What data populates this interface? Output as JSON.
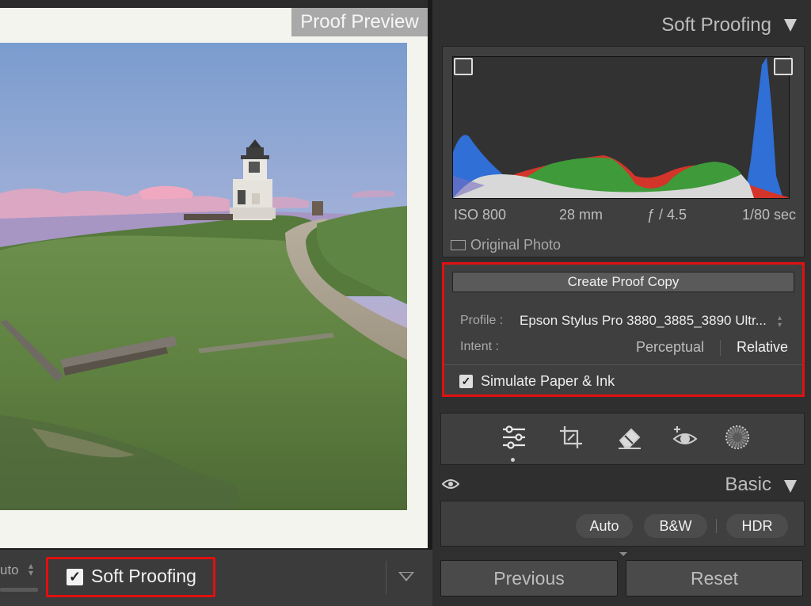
{
  "canvas": {
    "proof_preview_label": "Proof Preview",
    "toolbar": {
      "auto_label": "uto",
      "soft_proofing_label": "Soft Proofing",
      "soft_proofing_checked": true,
      "checkmark": "✓"
    }
  },
  "right_panel": {
    "soft_proofing_title": "Soft Proofing",
    "histogram": {
      "exif": {
        "iso": "ISO 800",
        "focal": "28 mm",
        "aperture": "ƒ / 4.5",
        "shutter": "1/80 sec"
      },
      "original_photo_label": "Original Photo"
    },
    "proof": {
      "create_proof_copy_label": "Create Proof Copy",
      "profile_label": "Profile :",
      "profile_value": "Epson Stylus Pro 3880_3885_3890 Ultr...",
      "intent_label": "Intent :",
      "intent_options": [
        "Perceptual",
        "Relative"
      ],
      "intent_selected": "Relative",
      "simulate_label": "Simulate Paper & Ink",
      "simulate_checked": true,
      "checkmark": "✓"
    },
    "tools": [
      "edit-sliders-icon",
      "crop-icon",
      "healing-eraser-icon",
      "redeye-icon",
      "masking-icon"
    ],
    "basic": {
      "title": "Basic",
      "auto_label": "Auto",
      "bw_label": "B&W",
      "hdr_label": "HDR"
    },
    "previous_label": "Previous",
    "reset_label": "Reset"
  }
}
